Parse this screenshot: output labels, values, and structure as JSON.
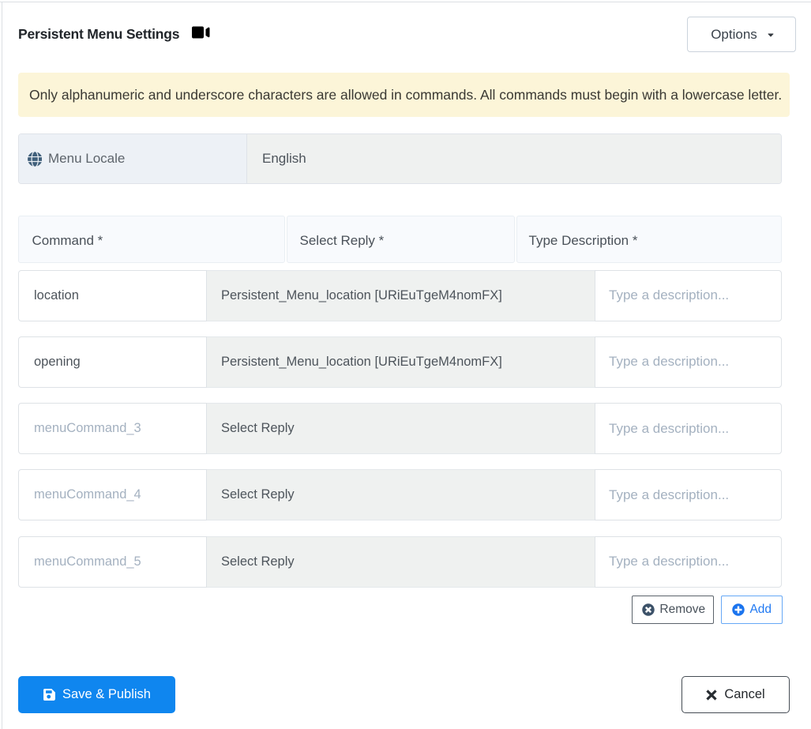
{
  "header": {
    "title": "Persistent Menu Settings",
    "options_label": "Options"
  },
  "alert": {
    "text": "Only alphanumeric and underscore characters are allowed in commands. All commands must begin with a lowercase letter."
  },
  "locale": {
    "label": "Menu Locale",
    "value": "English"
  },
  "table": {
    "headers": [
      "Command *",
      "Select Reply *",
      "Type Description *"
    ],
    "rows": [
      {
        "command": "location",
        "command_is_placeholder": false,
        "reply": "Persistent_Menu_location [URiEuTgeM4nomFX]",
        "description_placeholder": "Type a description..."
      },
      {
        "command": "opening",
        "command_is_placeholder": false,
        "reply": "Persistent_Menu_location [URiEuTgeM4nomFX]",
        "description_placeholder": "Type a description..."
      },
      {
        "command": "menuCommand_3",
        "command_is_placeholder": true,
        "reply": "Select Reply",
        "description_placeholder": "Type a description..."
      },
      {
        "command": "menuCommand_4",
        "command_is_placeholder": true,
        "reply": "Select Reply",
        "description_placeholder": "Type a description..."
      },
      {
        "command": "menuCommand_5",
        "command_is_placeholder": true,
        "reply": "Select Reply",
        "description_placeholder": "Type a description..."
      }
    ]
  },
  "actions": {
    "remove_label": "Remove",
    "add_label": "Add"
  },
  "footer": {
    "save_label": "Save & Publish",
    "cancel_label": "Cancel"
  },
  "colors": {
    "primary_blue": "#0f86ef",
    "add_blue": "#1b74ee",
    "alert_bg": "#fcf5d8",
    "select_bg": "#eff1f0"
  }
}
